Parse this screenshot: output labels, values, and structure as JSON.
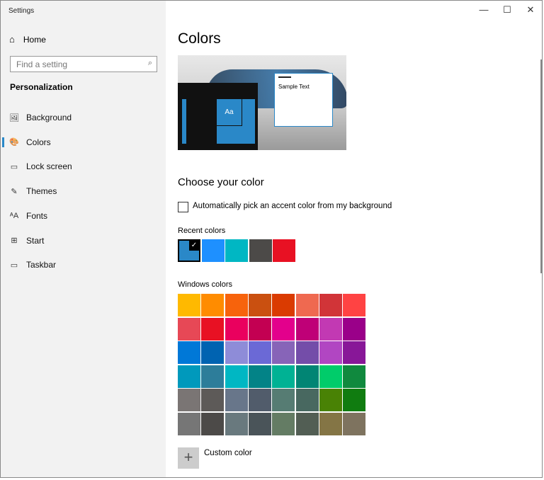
{
  "window": {
    "title": "Settings",
    "minimize": "—",
    "maximize": "☐",
    "close": "✕"
  },
  "sidebar": {
    "home": "Home",
    "search_placeholder": "Find a setting",
    "section": "Personalization",
    "items": [
      {
        "label": "Background",
        "icon": "🖼"
      },
      {
        "label": "Colors",
        "icon": "🎨",
        "active": true
      },
      {
        "label": "Lock screen",
        "icon": "▭"
      },
      {
        "label": "Themes",
        "icon": "✎"
      },
      {
        "label": "Fonts",
        "icon": "ᴬA"
      },
      {
        "label": "Start",
        "icon": "⊞"
      },
      {
        "label": "Taskbar",
        "icon": "▭"
      }
    ]
  },
  "main": {
    "title": "Colors",
    "preview": {
      "tile_text": "Aa",
      "sample_text": "Sample Text"
    },
    "choose_heading": "Choose your color",
    "auto_pick_label": "Automatically pick an accent color from my background",
    "auto_pick_checked": false,
    "recent_label": "Recent colors",
    "recent_colors": [
      "#2A88C8",
      "#1E90FF",
      "#00B7C3",
      "#4C4A48",
      "#E81123"
    ],
    "recent_selected": 0,
    "windows_label": "Windows colors",
    "windows_colors": [
      [
        "#FFB900",
        "#FF8C00",
        "#F7630C",
        "#CA5010",
        "#DA3B01",
        "#EF6950",
        "#D13438",
        "#FF4343"
      ],
      [
        "#E74856",
        "#E81123",
        "#EA005E",
        "#C30052",
        "#E3008C",
        "#BF0077",
        "#C239B3",
        "#9A0089"
      ],
      [
        "#0078D7",
        "#0063B1",
        "#8E8CD8",
        "#6B69D6",
        "#8764B8",
        "#744DA9",
        "#B146C2",
        "#881798"
      ],
      [
        "#0099BC",
        "#2D7D9A",
        "#00B7C3",
        "#038387",
        "#00B294",
        "#018574",
        "#00CC6A",
        "#10893E"
      ],
      [
        "#7A7574",
        "#5D5A58",
        "#68768A",
        "#515C6B",
        "#567C73",
        "#486860",
        "#498205",
        "#107C10"
      ],
      [
        "#767676",
        "#4C4A48",
        "#69797E",
        "#4A5459",
        "#647C64",
        "#525E54",
        "#847545",
        "#7E735F"
      ]
    ],
    "custom_color_label": "Custom color",
    "custom_icon": "+"
  }
}
